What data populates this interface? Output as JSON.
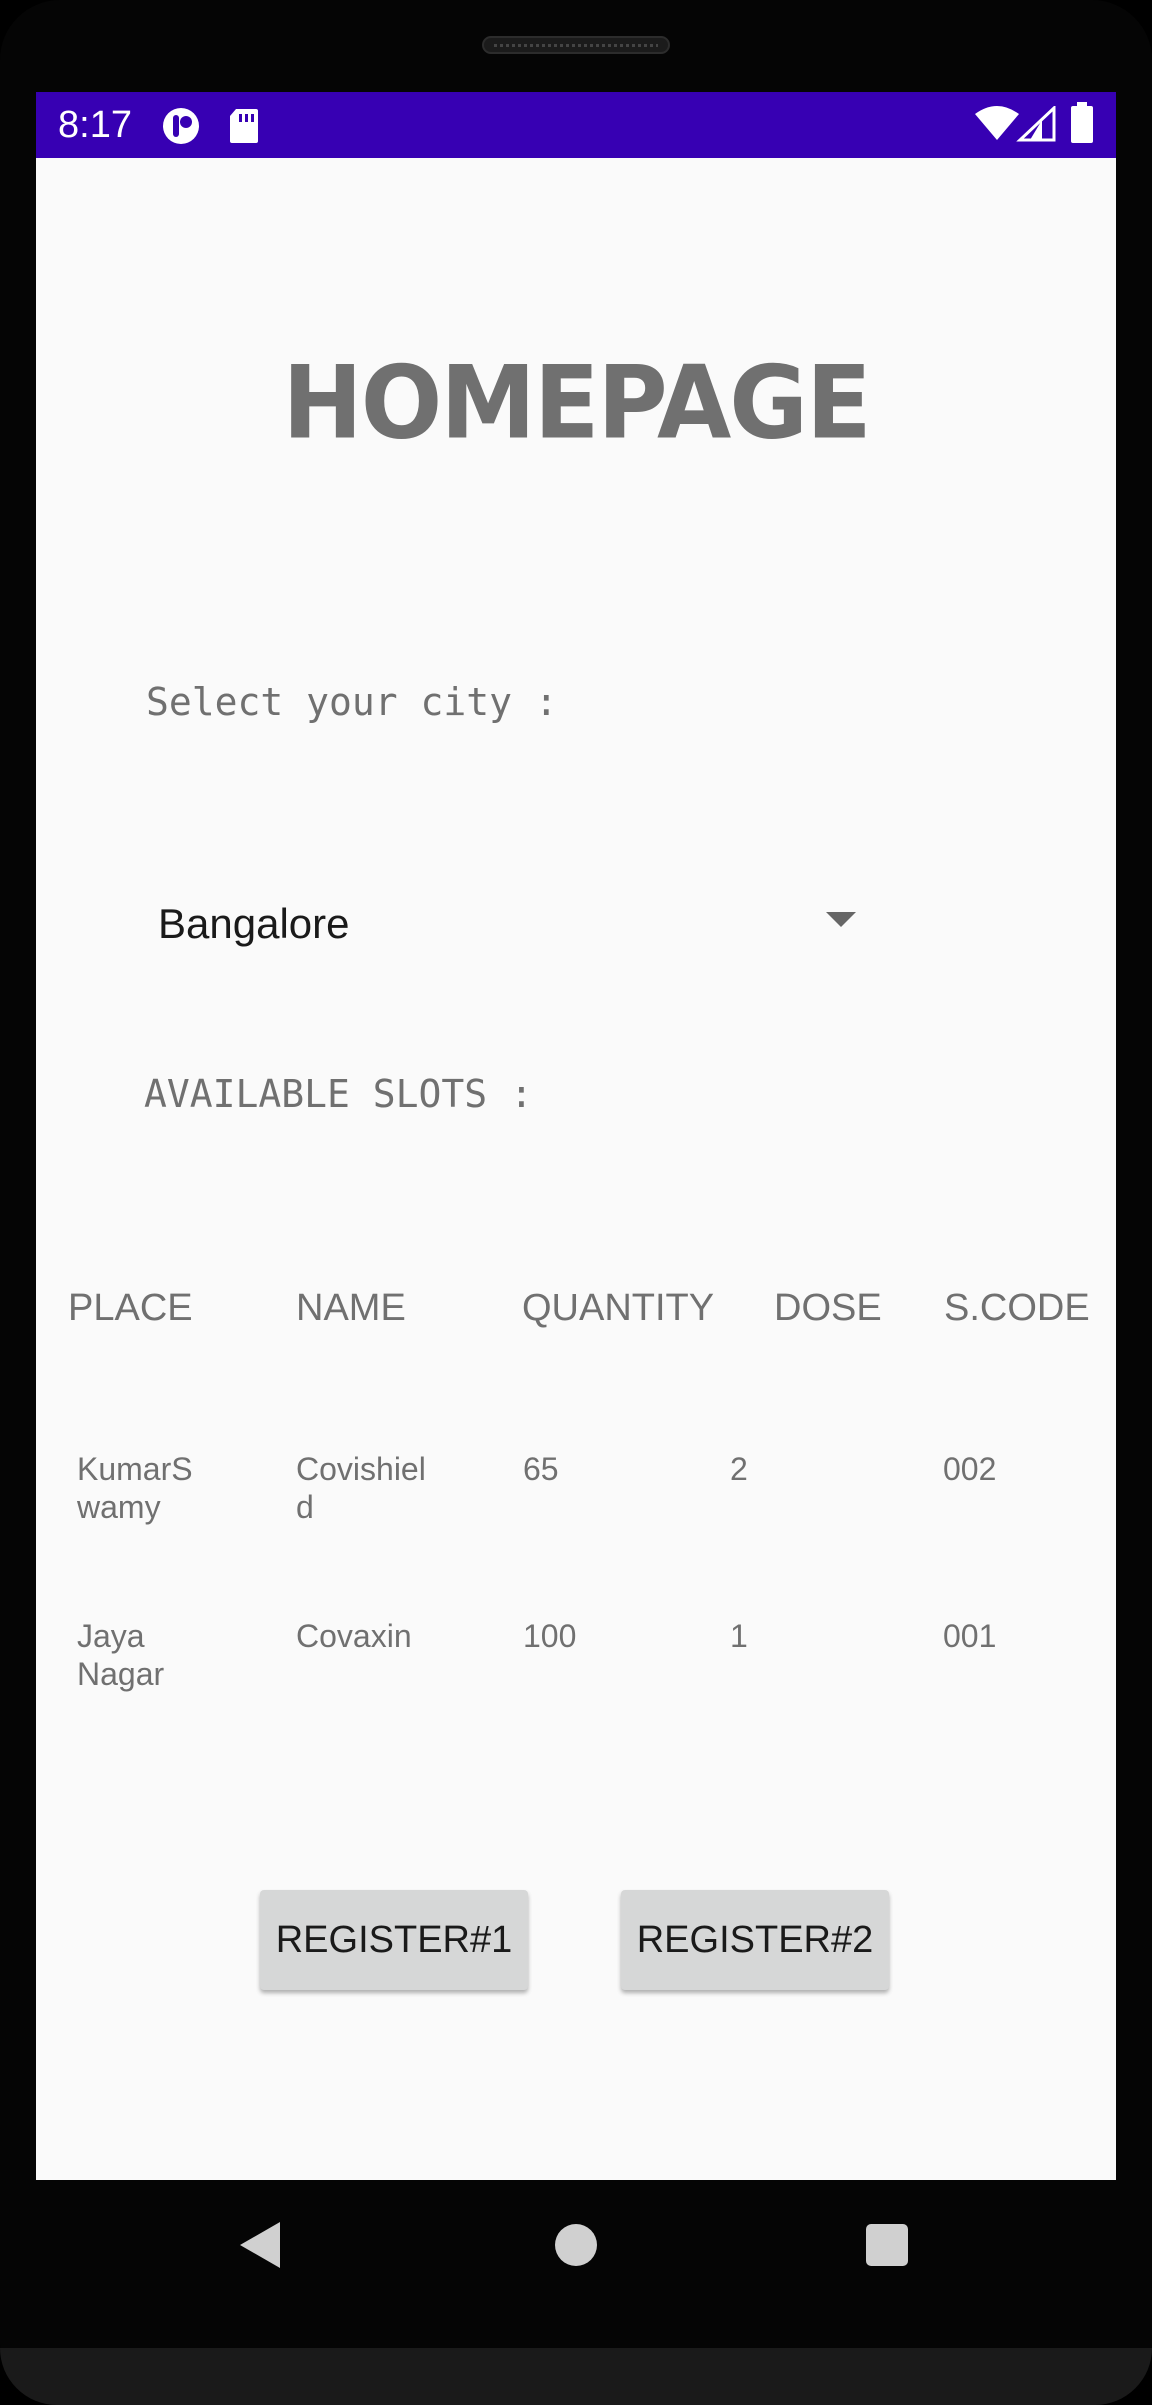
{
  "status_bar": {
    "time": "8:17",
    "color": "#3700b3"
  },
  "page": {
    "title": "HOMEPAGE",
    "city_label": "Select your city :",
    "city_selected": "Bangalore",
    "slots_label": "AVAILABLE SLOTS :"
  },
  "table": {
    "headers": [
      "PLACE",
      "NAME",
      "QUANTITY",
      "DOSE",
      "S.CODE"
    ],
    "rows": [
      {
        "place": "KumarSwamy",
        "name": "Covishield",
        "quantity": "65",
        "dose": "2",
        "scode": "002"
      },
      {
        "place": "Jaya Nagar",
        "name": "Covaxin",
        "quantity": "100",
        "dose": "1",
        "scode": "001"
      }
    ]
  },
  "buttons": {
    "register1": "REGISTER#1",
    "register2": "REGISTER#2"
  },
  "nav": {
    "icons": [
      "back-icon",
      "home-icon",
      "recents-icon"
    ]
  }
}
